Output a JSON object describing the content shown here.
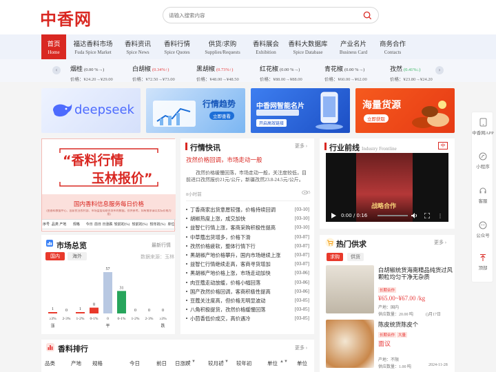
{
  "header": {
    "logo": "中香网",
    "search_placeholder": "请输入搜索内容"
  },
  "nav": [
    {
      "zh": "首页",
      "en": "Home",
      "active": true
    },
    {
      "zh": "福达香料市场",
      "en": "Fuda Spice Market"
    },
    {
      "zh": "香料资讯",
      "en": "Spice News"
    },
    {
      "zh": "香料行情",
      "en": "Spice Quotes"
    },
    {
      "zh": "供货/求购",
      "en": "Supplies/Requests"
    },
    {
      "zh": "香料展会",
      "en": "Exhibition"
    },
    {
      "zh": "香料大数据库",
      "en": "Spice Database"
    },
    {
      "zh": "产业名片",
      "en": "Business Card"
    },
    {
      "zh": "商务合作",
      "en": "Contacts"
    }
  ],
  "ticker": [
    {
      "name": "烟桂",
      "change": "(0.00 %→)",
      "price": "价格：¥24.20→¥29.00",
      "cls": "flat"
    },
    {
      "name": "白胡椒",
      "change": "(0.34%↑)",
      "price": "价格：¥72.50→¥73.00",
      "cls": "up"
    },
    {
      "name": "黑胡椒",
      "change": "(0.73%↑)",
      "price": "价格：¥48.00→¥48.50",
      "cls": "up"
    },
    {
      "name": "红花椒",
      "change": "(0.00 %→)",
      "price": "价格：¥88.00→¥88.00",
      "cls": "flat"
    },
    {
      "name": "青花椒",
      "change": "(0.00 %→)",
      "price": "价格：¥60.00→¥62.00",
      "cls": "flat"
    },
    {
      "name": "孜然",
      "change": "(0.41%↓)",
      "price": "价格：¥23.80→¥24.20",
      "cls": "grn"
    }
  ],
  "banners": [
    {
      "text": "deepseek",
      "accent": "#3b5bdb"
    },
    {
      "text": "行情趋势",
      "sub": "立即查看",
      "accent": "#1d6fd8"
    },
    {
      "text": "中香网智能名片",
      "sub": "开启高效链接",
      "accent": "#1f63d6"
    },
    {
      "text": "海量货源",
      "sub": "立即获取",
      "accent": "#ee4d1c"
    }
  ],
  "promo": {
    "line1": "“香料行情",
    "line2": "玉林报价”",
    "caption": "国内香料信息服务每日价格",
    "small": "(由香料数据中心、国家农业农村部、市场监管局联合发布的数据，仅供参考，如有需求请以实际价格为准)",
    "headers": [
      "序号",
      "品类",
      "产地",
      "规格",
      "今日",
      "前日",
      "日涨跌",
      "较前初(%)",
      "较前初(%)",
      "较年初(%)",
      "单位"
    ]
  },
  "market": {
    "title": "市场总览",
    "more": "最新行情",
    "tabs": [
      "国内",
      "海外"
    ],
    "source": "数据来源：玉林",
    "chart_data": {
      "type": "bar",
      "categories": [
        "≥3%",
        "2-3%",
        "1-2%",
        "0-1%",
        "0",
        "0-1%",
        "1-2%",
        "2-3%",
        "≥3%"
      ],
      "values": [
        1,
        0,
        1,
        8,
        57,
        31,
        0,
        0,
        0
      ],
      "value_labels": [
        "1",
        "0",
        "1",
        "8",
        "57",
        "31",
        "0",
        "0",
        "0"
      ],
      "colors": [
        "#e8392b",
        "#e8392b",
        "#e8392b",
        "#e8392b",
        "#b8c8e2",
        "#27a55c",
        "#27a55c",
        "#27a55c",
        "#27a55c"
      ],
      "groups": [
        "涨",
        "平",
        "跌"
      ]
    }
  },
  "news": {
    "title": "行情快讯",
    "more": "更多 ›",
    "headline": "孜然价格回调，市场走动一般",
    "body": "孜然价格缓慢回落，市场走动一般，关注度较低，目前进口孜然报价21元/公斤，新疆孜然23.8-24.5元/公斤。",
    "time": "8小时前",
    "views": "15",
    "items": [
      {
        "t": "丁香商家出货意愿较强，价格持续回调",
        "d": "[03-10]"
      },
      {
        "t": "胡椒热度上涨，成交加快",
        "d": "[03-10]"
      },
      {
        "t": "益智仁行情上涨，客商采购积极性提高",
        "d": "[03-10]"
      },
      {
        "t": "中草蔻出货增多，价格下滑",
        "d": "[03-07]"
      },
      {
        "t": "孜然价格疲软，整体行情下行",
        "d": "[03-07]"
      },
      {
        "t": "黑胡椒产地价格攀升，国内市场继续上涨",
        "d": "[03-07]"
      },
      {
        "t": "益智仁行情继续走高，客商寻货增加",
        "d": "[03-07]"
      },
      {
        "t": "黑胡椒产地价格上涨，市场走动加快",
        "d": "[03-06]"
      },
      {
        "t": "肉豆蔻走动放缓，价格小幅回落",
        "d": "[03-06]"
      },
      {
        "t": "国产孜然价格回调，客商积极性提高",
        "d": "[03-06]"
      },
      {
        "t": "豆蔻关注度高，但价格无明显波动",
        "d": "[03-05]"
      },
      {
        "t": "八角积极提货，孜然价格缓慢回落",
        "d": "[03-05]"
      },
      {
        "t": "小茴香低价成交，高价遇冷",
        "d": "[03-05]"
      }
    ]
  },
  "frontline": {
    "title": "行业前线",
    "title_en": "Industry Frontline",
    "badge": "中",
    "video_time": "0:00 / 0:16",
    "video_caption": "战略合作"
  },
  "supply": {
    "title": "热门供求",
    "more": "更多 ›",
    "tabs": [
      "求购",
      "供货"
    ],
    "items": [
      {
        "title": "白胡椒统货海南精品纯货过风颗粒均匀干净无杂质",
        "tag": "长期合作",
        "price": "¥65.00~¥67.00 /kg",
        "origin": "产地：国内",
        "qty": "供应数量：20.00 吨",
        "date": "()月17日"
      },
      {
        "title": "陈皮统货陈皮个",
        "tag1": "长期合作",
        "tag2": "大量",
        "price": "面议",
        "origin": "产地：不限",
        "qty": "供应数量：1.00 吨",
        "date": "2024-11-28"
      }
    ]
  },
  "ranking": {
    "title": "香料排行",
    "more": "更多 ›",
    "headers": [
      "品类",
      "产地",
      "规格",
      "今日",
      "前日",
      "日涨跌",
      "较月初",
      "较年初",
      "单位"
    ]
  },
  "sidebar": [
    {
      "label": "中香网APP"
    },
    {
      "label": "小程序"
    },
    {
      "label": "客服"
    },
    {
      "label": "公众号"
    },
    {
      "label": "顶部"
    }
  ]
}
